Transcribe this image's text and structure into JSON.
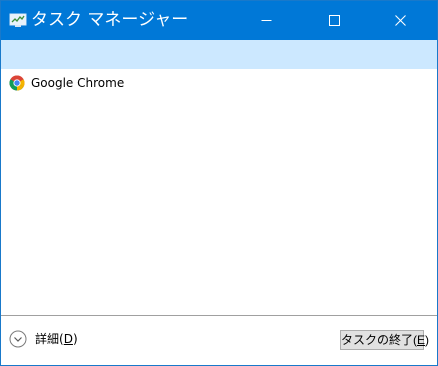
{
  "window": {
    "title": "タスク マネージャー"
  },
  "titlebar": {
    "icons": {
      "app": "task-manager-icon",
      "minimize": "minimize-icon",
      "maximize": "maximize-icon",
      "close": "close-icon"
    },
    "color": "#0078d7"
  },
  "header_band": {
    "color": "#cce8ff"
  },
  "process_list": {
    "items": [
      {
        "label": "Google Chrome",
        "icon": "chrome-icon"
      }
    ]
  },
  "footer": {
    "details": {
      "label": "詳細",
      "accel_open": "(",
      "accel_key": "D",
      "accel_close": ")",
      "icon": "chevron-down-icon"
    },
    "end_task": {
      "label": "タスクの終了",
      "accel_open": "(",
      "accel_key": "E",
      "accel_close": ")"
    }
  }
}
